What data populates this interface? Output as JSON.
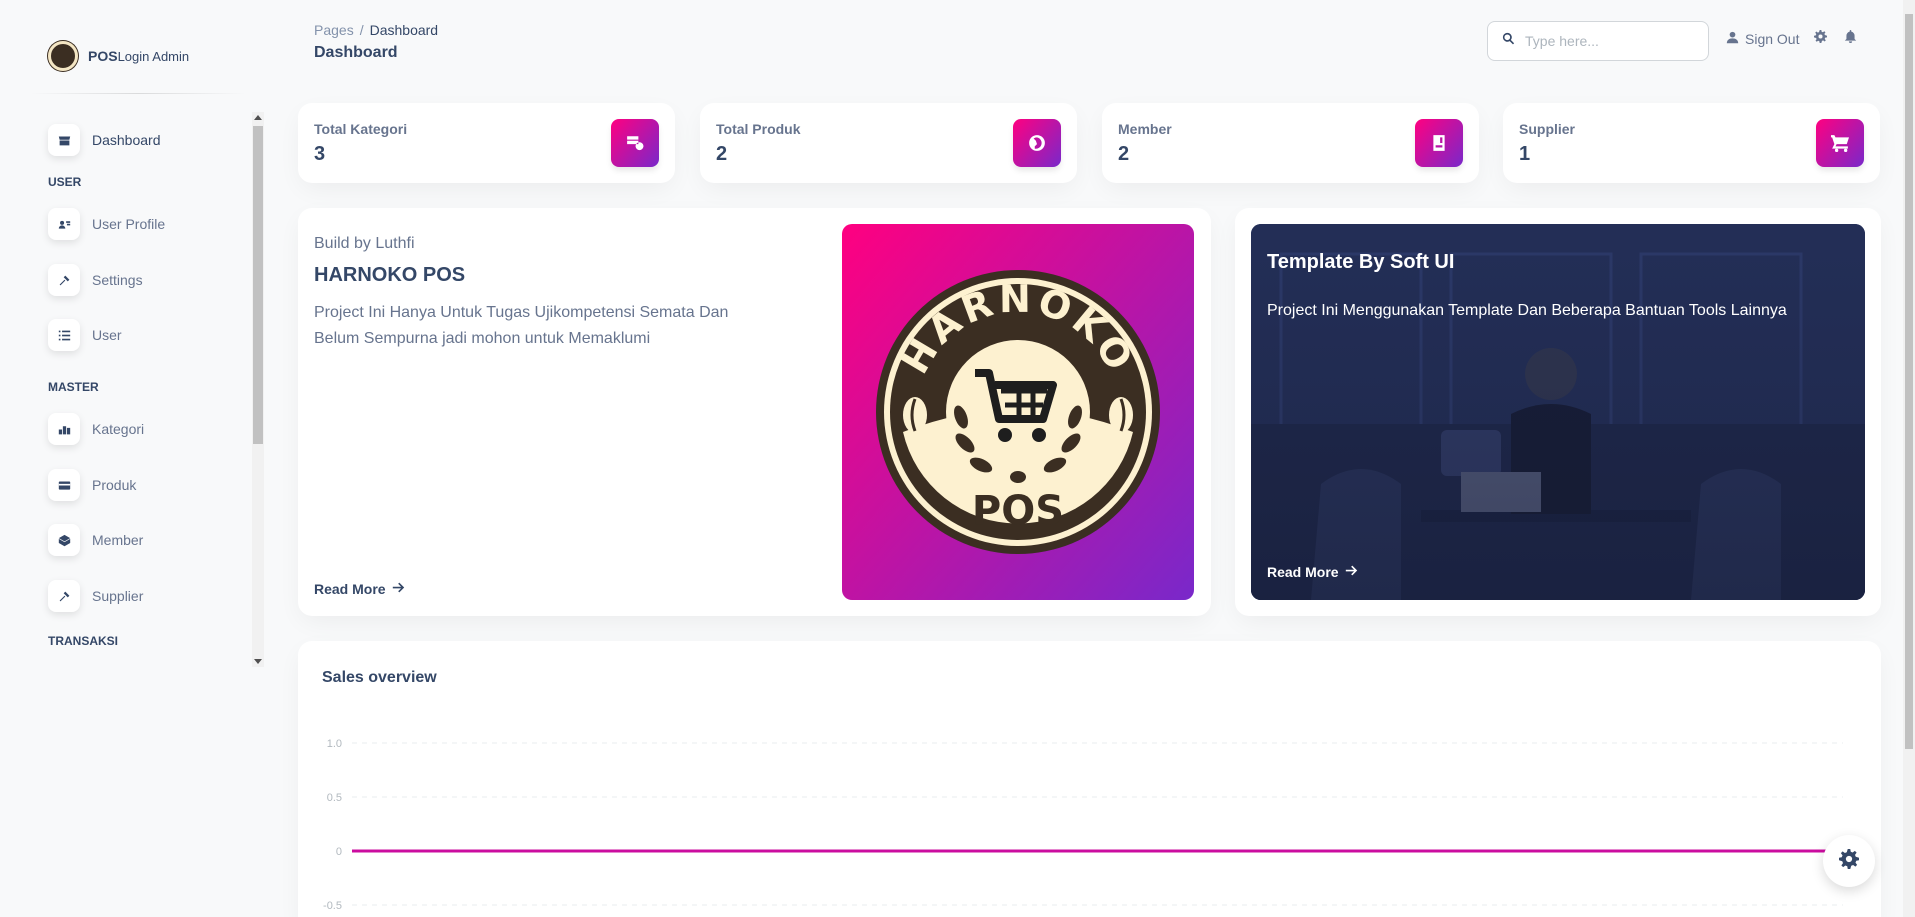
{
  "brand": {
    "name_bold": "POS",
    "name_rest": "Login Admin"
  },
  "sidebar": {
    "items": [
      {
        "label": "Dashboard",
        "icon": "store-icon"
      },
      {
        "label": "User Profile",
        "icon": "user-card-icon"
      },
      {
        "label": "Settings",
        "icon": "wrench-icon"
      },
      {
        "label": "User",
        "icon": "list-icon"
      },
      {
        "label": "Kategori",
        "icon": "chart-bars-icon"
      },
      {
        "label": "Produk",
        "icon": "credit-card-icon"
      },
      {
        "label": "Member",
        "icon": "box-icon"
      },
      {
        "label": "Supplier",
        "icon": "wrench-icon"
      }
    ],
    "sections": {
      "user": "USER",
      "master": "MASTER",
      "transaksi": "TRANSAKSI"
    }
  },
  "header": {
    "breadcrumb_root": "Pages",
    "breadcrumb_sep": "/",
    "breadcrumb_current": "Dashboard",
    "title": "Dashboard",
    "search_placeholder": "Type here...",
    "signout_label": "Sign Out"
  },
  "stats": [
    {
      "label": "Total Kategori",
      "value": "3",
      "icon": "database-icon"
    },
    {
      "label": "Total Produk",
      "value": "2",
      "icon": "globe-icon"
    },
    {
      "label": "Member",
      "value": "2",
      "icon": "file-user-icon"
    },
    {
      "label": "Supplier",
      "value": "1",
      "icon": "cart-icon"
    }
  ],
  "build_card": {
    "kicker": "Build by Luthfi",
    "title": "HARNOKO POS",
    "description": "Project Ini Hanya Untuk Tugas Ujikompetensi Semata Dan Belum Sempurna jadi mohon untuk Memaklumi",
    "read_more": "Read More",
    "logo_top_text": "HARNOKO",
    "logo_bottom_text": "POS"
  },
  "template_card": {
    "title": "Template By Soft UI",
    "description": "Project Ini Menggunakan Template Dan Beberapa Bantuan Tools Lainnya",
    "read_more": "Read More"
  },
  "sales": {
    "title": "Sales overview",
    "chart_data": {
      "type": "line",
      "title": "Sales overview",
      "xlabel": "",
      "ylabel": "",
      "ylim": [
        -0.5,
        1.0
      ],
      "y_ticks": [
        "1.0",
        "0.5",
        "0",
        "-0.5"
      ],
      "series": [
        {
          "values": [
            0,
            0
          ]
        }
      ],
      "line_color": "#cb0c9f",
      "grid": true
    }
  },
  "colors": {
    "accent_gradient_start": "#7928ca",
    "accent_gradient_end": "#ff0080",
    "text_dark": "#344767",
    "text_muted": "#67748e"
  }
}
